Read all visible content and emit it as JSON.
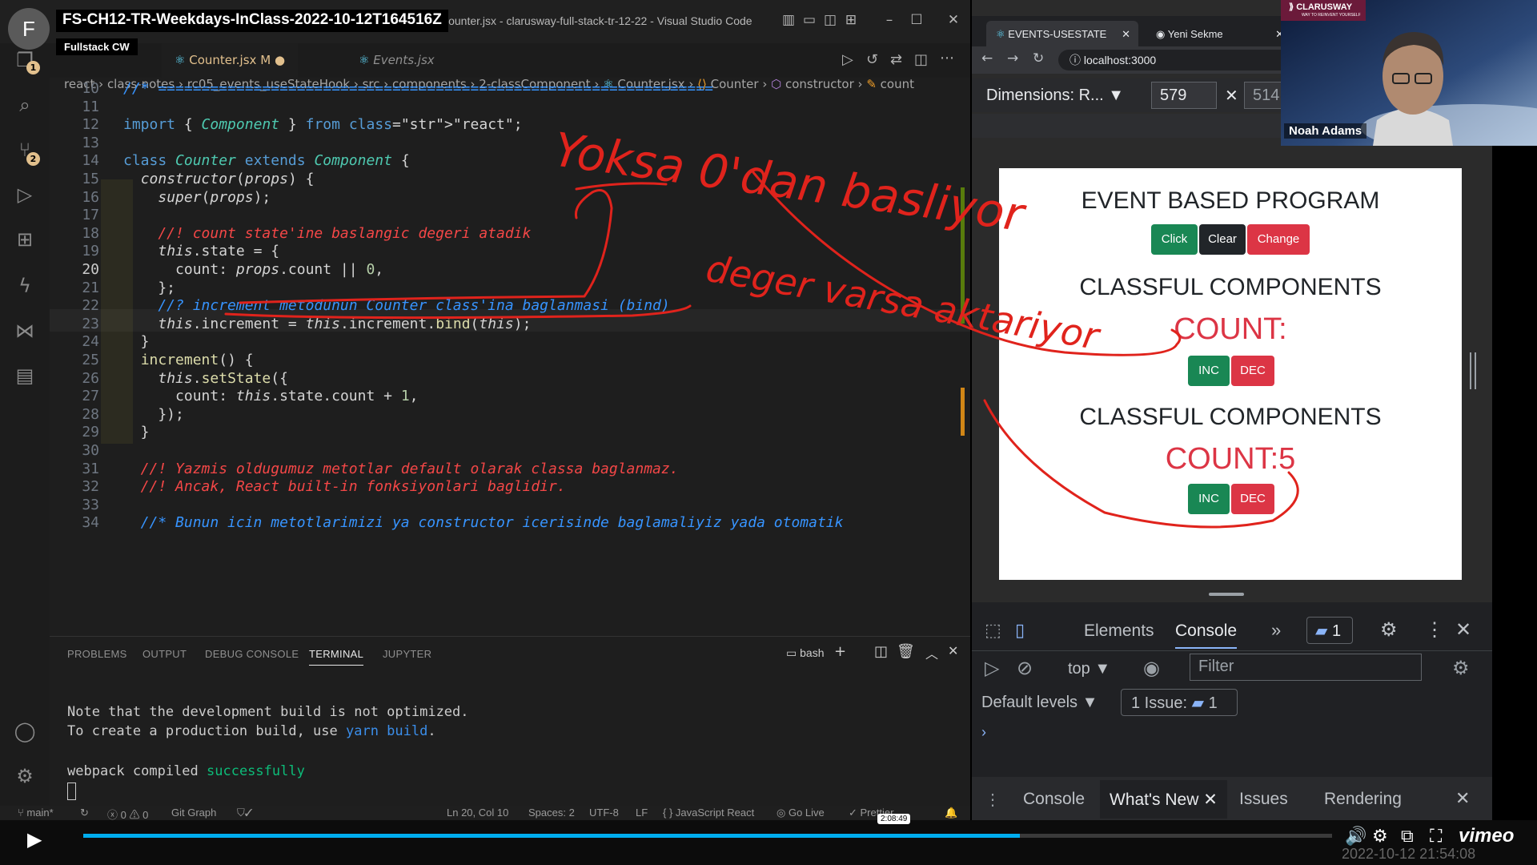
{
  "video": {
    "title": "FS-CH12-TR-Weekdays-InClass-2022-10-12T164516Z",
    "channel": "Fullstack CW",
    "avatar_letter": "F",
    "elapsed": "2:08:49",
    "timestamp": "2022-10-12 21:54:08",
    "brand": "vimeo",
    "progress_fraction": 0.75
  },
  "vscode": {
    "window_title": "Counter.jsx - clarusway-full-stack-tr-12-22 - Visual Studio Code",
    "activity_badges": {
      "explorer": "1",
      "scm": "2"
    },
    "tabs": [
      {
        "label": "Counter.jsx",
        "modified": "M",
        "active": true
      },
      {
        "label": "Events.jsx",
        "active": false
      }
    ],
    "breadcrumb": [
      "react",
      "class-notes",
      "rc05_events_useStateHook",
      "src",
      "components",
      "2-classComponent",
      "Counter.jsx",
      "Counter",
      "constructor",
      "count"
    ],
    "lines": [
      {
        "n": "10",
        "t": "//* ================================================================"
      },
      {
        "n": "11",
        "t": ""
      },
      {
        "n": "12",
        "t": "import { Component } from \"react\";"
      },
      {
        "n": "13",
        "t": ""
      },
      {
        "n": "14",
        "t": "class Counter extends Component {"
      },
      {
        "n": "15",
        "t": "  constructor(props) {"
      },
      {
        "n": "16",
        "t": "    super(props);"
      },
      {
        "n": "17",
        "t": ""
      },
      {
        "n": "18",
        "t": "    //! count state'ine baslangic degeri atadik"
      },
      {
        "n": "19",
        "t": "    this.state = {"
      },
      {
        "n": "20",
        "t": "      count: props.count || 0,"
      },
      {
        "n": "21",
        "t": "    };"
      },
      {
        "n": "22",
        "t": "    //? increment metodunun Counter class'ina baglanmasi (bind)"
      },
      {
        "n": "23",
        "t": "    this.increment = this.increment.bind(this);"
      },
      {
        "n": "24",
        "t": "  }"
      },
      {
        "n": "25",
        "t": "  increment() {"
      },
      {
        "n": "26",
        "t": "    this.setState({"
      },
      {
        "n": "27",
        "t": "      count: this.state.count + 1,"
      },
      {
        "n": "28",
        "t": "    });"
      },
      {
        "n": "29",
        "t": "  }"
      },
      {
        "n": "30",
        "t": ""
      },
      {
        "n": "31",
        "t": "  //! Yazmis oldugumuz metotlar default olarak classa baglanmaz."
      },
      {
        "n": "32",
        "t": "  //! Ancak, React built-in fonksiyonlari baglidir."
      },
      {
        "n": "33",
        "t": ""
      },
      {
        "n": "34",
        "t": "  //* Bunun icin metotlarimizi ya constructor icerisinde baglamaliyiz yada otomatik"
      }
    ],
    "panel_tabs": [
      "PROBLEMS",
      "OUTPUT",
      "DEBUG CONSOLE",
      "TERMINAL",
      "JUPYTER"
    ],
    "panel_active": "TERMINAL",
    "shell": "bash",
    "terminal": [
      "Note that the development build is not optimized.",
      "To create a production build, use yarn build.",
      "",
      "webpack compiled successfully"
    ],
    "status": {
      "branch": "main*",
      "errors": "0",
      "warnings": "0",
      "git_graph": "Git Graph",
      "position": "Ln 20, Col 10",
      "spaces": "Spaces: 2",
      "encoding": "UTF-8",
      "eol": "LF",
      "language": "JavaScript React",
      "go_live": "Go Live",
      "prettier": "Prettier"
    }
  },
  "handwriting": [
    "Yoksa 0'dan basliyor",
    "deger varsa aktariyor"
  ],
  "browser": {
    "tabs": [
      {
        "label": "EVENTS-USESTATE",
        "active": true
      },
      {
        "label": "Yeni Sekme",
        "active": false
      }
    ],
    "url": "localhost:3000",
    "dimensions": {
      "preset": "Dimensions: R...",
      "width": "579",
      "height": "514"
    },
    "app": {
      "heading1": "EVENT BASED PROGRAM",
      "buttons1": [
        "Click",
        "Clear",
        "Change"
      ],
      "heading2": "CLASSFUL COMPONENTS",
      "count_a": "COUNT:",
      "heading3": "CLASSFUL COMPONENTS",
      "count_b": "COUNT:5",
      "inc": "INC",
      "dec": "DEC"
    },
    "devtools": {
      "tabs": [
        "Elements",
        "Console"
      ],
      "active_tab": "Console",
      "issues_badge": "1",
      "context": "top",
      "filter_placeholder": "Filter",
      "levels": "Default levels",
      "issues": "1 Issue:",
      "issues_count": "1",
      "drawer_tabs": [
        "Console",
        "What's New",
        "Issues",
        "Rendering"
      ],
      "drawer_active": "What's New"
    }
  },
  "webcam": {
    "name": "Noah Adams",
    "logo": "CLARUSWAY",
    "tagline": "WAY TO REINVENT YOURSELF"
  },
  "colors": {
    "annotation": "#e0231c",
    "success": "#198754",
    "danger": "#dc3545",
    "dark": "#212529",
    "editor_bg": "#1e1e1e"
  }
}
